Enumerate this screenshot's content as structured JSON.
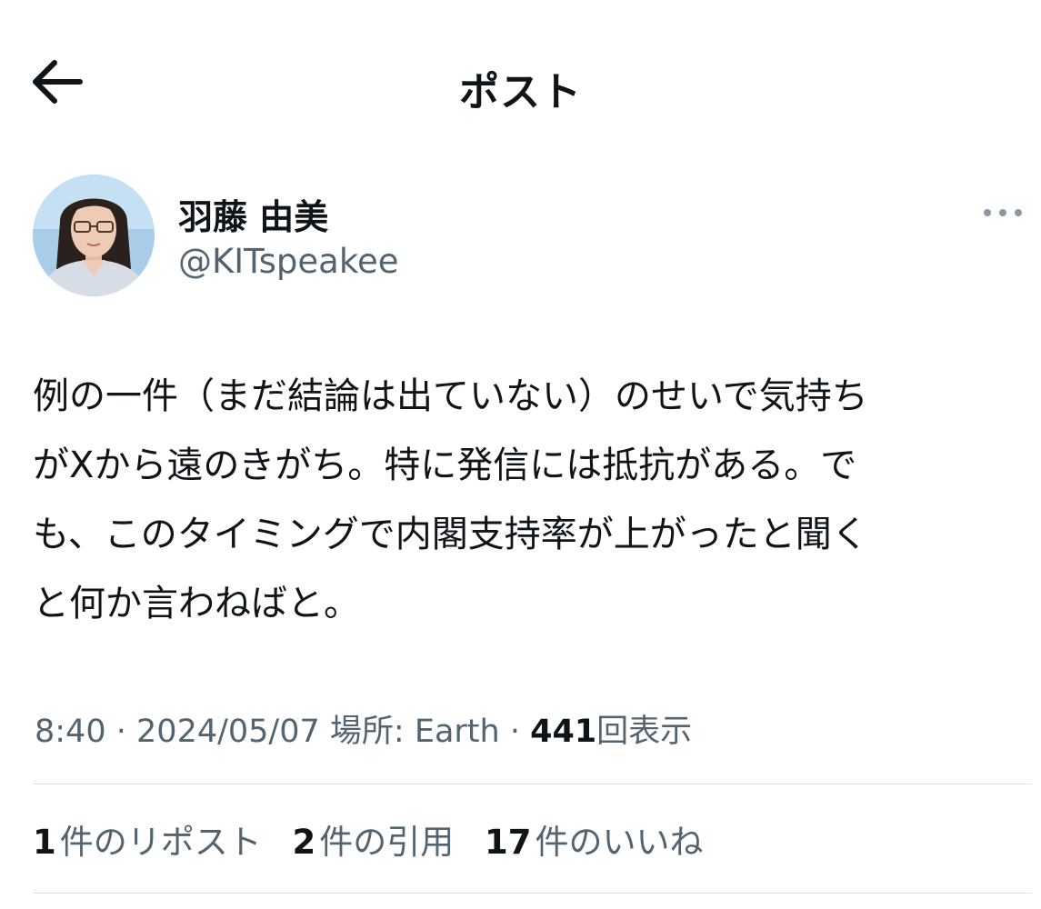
{
  "header": {
    "title": "ポスト",
    "back_icon": "arrow-left-icon"
  },
  "author": {
    "display_name": "羽藤 由美",
    "handle": "@KITspeakee",
    "avatar_icon": "profile-photo",
    "more_icon": "more-horizontal-icon"
  },
  "post": {
    "text": "例の一件（まだ結論は出ていない）のせいで気持ち\nがXから遠のきがち。特に発信には抵抗がある。で\nも、このタイミングで内閣支持率が上がったと聞く\nと何か言わねばと。"
  },
  "meta": {
    "time": "8:40",
    "separator": "·",
    "date": "2024/05/07",
    "location_label": "場所: Earth",
    "views_count": "441",
    "views_label": "回表示"
  },
  "stats": [
    {
      "num": "1",
      "label": "件のリポスト"
    },
    {
      "num": "2",
      "label": "件の引用"
    },
    {
      "num": "17",
      "label": "件のいいね"
    }
  ],
  "colors": {
    "text": "#0f1419",
    "secondary": "#536471",
    "divider": "#dfe3e6",
    "background": "#ffffff"
  }
}
